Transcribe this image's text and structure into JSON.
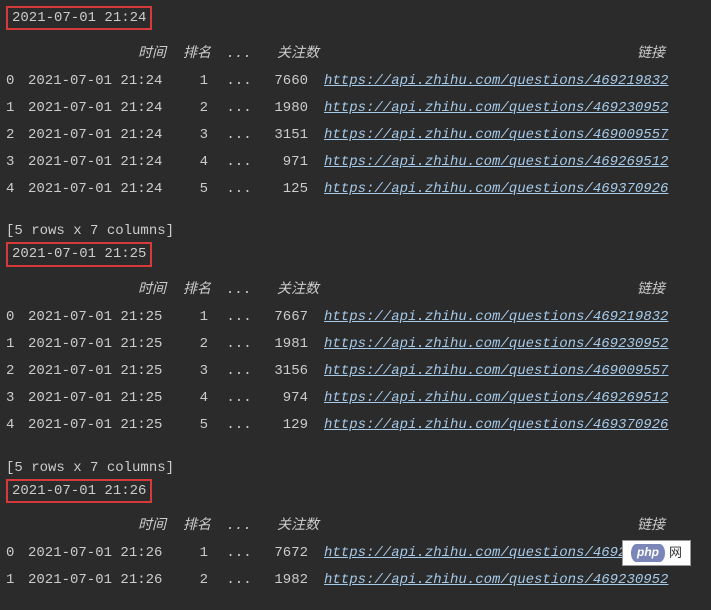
{
  "headers": {
    "time": "时间",
    "rank": "排名",
    "ellipsis": "...",
    "watch": "关注数",
    "link": "链接"
  },
  "summary_text": "[5 rows x 7 columns]",
  "badge": {
    "logo": "php",
    "suffix": "网"
  },
  "blocks": [
    {
      "timestamp": "2021-07-01 21:24",
      "rows": [
        {
          "idx": "0",
          "time": "2021-07-01 21:24",
          "rank": "1",
          "ell": "...",
          "watch": "7660",
          "link": "https://api.zhihu.com/questions/469219832"
        },
        {
          "idx": "1",
          "time": "2021-07-01 21:24",
          "rank": "2",
          "ell": "...",
          "watch": "1980",
          "link": "https://api.zhihu.com/questions/469230952"
        },
        {
          "idx": "2",
          "time": "2021-07-01 21:24",
          "rank": "3",
          "ell": "...",
          "watch": "3151",
          "link": "https://api.zhihu.com/questions/469009557"
        },
        {
          "idx": "3",
          "time": "2021-07-01 21:24",
          "rank": "4",
          "ell": "...",
          "watch": "971",
          "link": "https://api.zhihu.com/questions/469269512"
        },
        {
          "idx": "4",
          "time": "2021-07-01 21:24",
          "rank": "5",
          "ell": "...",
          "watch": "125",
          "link": "https://api.zhihu.com/questions/469370926"
        }
      ]
    },
    {
      "timestamp": "2021-07-01 21:25",
      "rows": [
        {
          "idx": "0",
          "time": "2021-07-01 21:25",
          "rank": "1",
          "ell": "...",
          "watch": "7667",
          "link": "https://api.zhihu.com/questions/469219832"
        },
        {
          "idx": "1",
          "time": "2021-07-01 21:25",
          "rank": "2",
          "ell": "...",
          "watch": "1981",
          "link": "https://api.zhihu.com/questions/469230952"
        },
        {
          "idx": "2",
          "time": "2021-07-01 21:25",
          "rank": "3",
          "ell": "...",
          "watch": "3156",
          "link": "https://api.zhihu.com/questions/469009557"
        },
        {
          "idx": "3",
          "time": "2021-07-01 21:25",
          "rank": "4",
          "ell": "...",
          "watch": "974",
          "link": "https://api.zhihu.com/questions/469269512"
        },
        {
          "idx": "4",
          "time": "2021-07-01 21:25",
          "rank": "5",
          "ell": "...",
          "watch": "129",
          "link": "https://api.zhihu.com/questions/469370926"
        }
      ]
    },
    {
      "timestamp": "2021-07-01 21:26",
      "rows": [
        {
          "idx": "0",
          "time": "2021-07-01 21:26",
          "rank": "1",
          "ell": "...",
          "watch": "7672",
          "link": "https://api.zhihu.com/questions/4692199"
        },
        {
          "idx": "1",
          "time": "2021-07-01 21:26",
          "rank": "2",
          "ell": "...",
          "watch": "1982",
          "link": "https://api.zhihu.com/questions/469230952"
        }
      ]
    }
  ]
}
